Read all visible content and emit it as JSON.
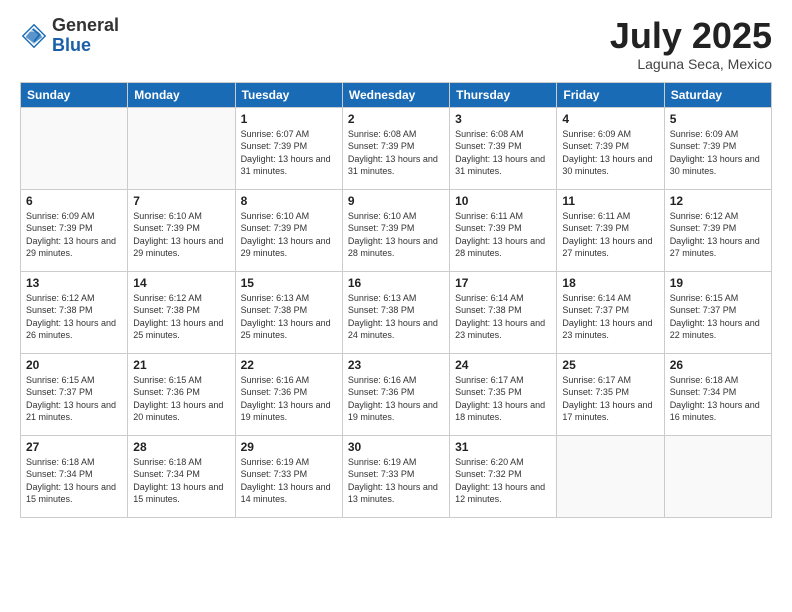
{
  "logo": {
    "general": "General",
    "blue": "Blue"
  },
  "header": {
    "month_year": "July 2025",
    "location": "Laguna Seca, Mexico"
  },
  "days_of_week": [
    "Sunday",
    "Monday",
    "Tuesday",
    "Wednesday",
    "Thursday",
    "Friday",
    "Saturday"
  ],
  "weeks": [
    [
      {
        "day": "",
        "info": ""
      },
      {
        "day": "",
        "info": ""
      },
      {
        "day": "1",
        "info": "Sunrise: 6:07 AM\nSunset: 7:39 PM\nDaylight: 13 hours and 31 minutes."
      },
      {
        "day": "2",
        "info": "Sunrise: 6:08 AM\nSunset: 7:39 PM\nDaylight: 13 hours and 31 minutes."
      },
      {
        "day": "3",
        "info": "Sunrise: 6:08 AM\nSunset: 7:39 PM\nDaylight: 13 hours and 31 minutes."
      },
      {
        "day": "4",
        "info": "Sunrise: 6:09 AM\nSunset: 7:39 PM\nDaylight: 13 hours and 30 minutes."
      },
      {
        "day": "5",
        "info": "Sunrise: 6:09 AM\nSunset: 7:39 PM\nDaylight: 13 hours and 30 minutes."
      }
    ],
    [
      {
        "day": "6",
        "info": "Sunrise: 6:09 AM\nSunset: 7:39 PM\nDaylight: 13 hours and 29 minutes."
      },
      {
        "day": "7",
        "info": "Sunrise: 6:10 AM\nSunset: 7:39 PM\nDaylight: 13 hours and 29 minutes."
      },
      {
        "day": "8",
        "info": "Sunrise: 6:10 AM\nSunset: 7:39 PM\nDaylight: 13 hours and 29 minutes."
      },
      {
        "day": "9",
        "info": "Sunrise: 6:10 AM\nSunset: 7:39 PM\nDaylight: 13 hours and 28 minutes."
      },
      {
        "day": "10",
        "info": "Sunrise: 6:11 AM\nSunset: 7:39 PM\nDaylight: 13 hours and 28 minutes."
      },
      {
        "day": "11",
        "info": "Sunrise: 6:11 AM\nSunset: 7:39 PM\nDaylight: 13 hours and 27 minutes."
      },
      {
        "day": "12",
        "info": "Sunrise: 6:12 AM\nSunset: 7:39 PM\nDaylight: 13 hours and 27 minutes."
      }
    ],
    [
      {
        "day": "13",
        "info": "Sunrise: 6:12 AM\nSunset: 7:38 PM\nDaylight: 13 hours and 26 minutes."
      },
      {
        "day": "14",
        "info": "Sunrise: 6:12 AM\nSunset: 7:38 PM\nDaylight: 13 hours and 25 minutes."
      },
      {
        "day": "15",
        "info": "Sunrise: 6:13 AM\nSunset: 7:38 PM\nDaylight: 13 hours and 25 minutes."
      },
      {
        "day": "16",
        "info": "Sunrise: 6:13 AM\nSunset: 7:38 PM\nDaylight: 13 hours and 24 minutes."
      },
      {
        "day": "17",
        "info": "Sunrise: 6:14 AM\nSunset: 7:38 PM\nDaylight: 13 hours and 23 minutes."
      },
      {
        "day": "18",
        "info": "Sunrise: 6:14 AM\nSunset: 7:37 PM\nDaylight: 13 hours and 23 minutes."
      },
      {
        "day": "19",
        "info": "Sunrise: 6:15 AM\nSunset: 7:37 PM\nDaylight: 13 hours and 22 minutes."
      }
    ],
    [
      {
        "day": "20",
        "info": "Sunrise: 6:15 AM\nSunset: 7:37 PM\nDaylight: 13 hours and 21 minutes."
      },
      {
        "day": "21",
        "info": "Sunrise: 6:15 AM\nSunset: 7:36 PM\nDaylight: 13 hours and 20 minutes."
      },
      {
        "day": "22",
        "info": "Sunrise: 6:16 AM\nSunset: 7:36 PM\nDaylight: 13 hours and 19 minutes."
      },
      {
        "day": "23",
        "info": "Sunrise: 6:16 AM\nSunset: 7:36 PM\nDaylight: 13 hours and 19 minutes."
      },
      {
        "day": "24",
        "info": "Sunrise: 6:17 AM\nSunset: 7:35 PM\nDaylight: 13 hours and 18 minutes."
      },
      {
        "day": "25",
        "info": "Sunrise: 6:17 AM\nSunset: 7:35 PM\nDaylight: 13 hours and 17 minutes."
      },
      {
        "day": "26",
        "info": "Sunrise: 6:18 AM\nSunset: 7:34 PM\nDaylight: 13 hours and 16 minutes."
      }
    ],
    [
      {
        "day": "27",
        "info": "Sunrise: 6:18 AM\nSunset: 7:34 PM\nDaylight: 13 hours and 15 minutes."
      },
      {
        "day": "28",
        "info": "Sunrise: 6:18 AM\nSunset: 7:34 PM\nDaylight: 13 hours and 15 minutes."
      },
      {
        "day": "29",
        "info": "Sunrise: 6:19 AM\nSunset: 7:33 PM\nDaylight: 13 hours and 14 minutes."
      },
      {
        "day": "30",
        "info": "Sunrise: 6:19 AM\nSunset: 7:33 PM\nDaylight: 13 hours and 13 minutes."
      },
      {
        "day": "31",
        "info": "Sunrise: 6:20 AM\nSunset: 7:32 PM\nDaylight: 13 hours and 12 minutes."
      },
      {
        "day": "",
        "info": ""
      },
      {
        "day": "",
        "info": ""
      }
    ]
  ]
}
